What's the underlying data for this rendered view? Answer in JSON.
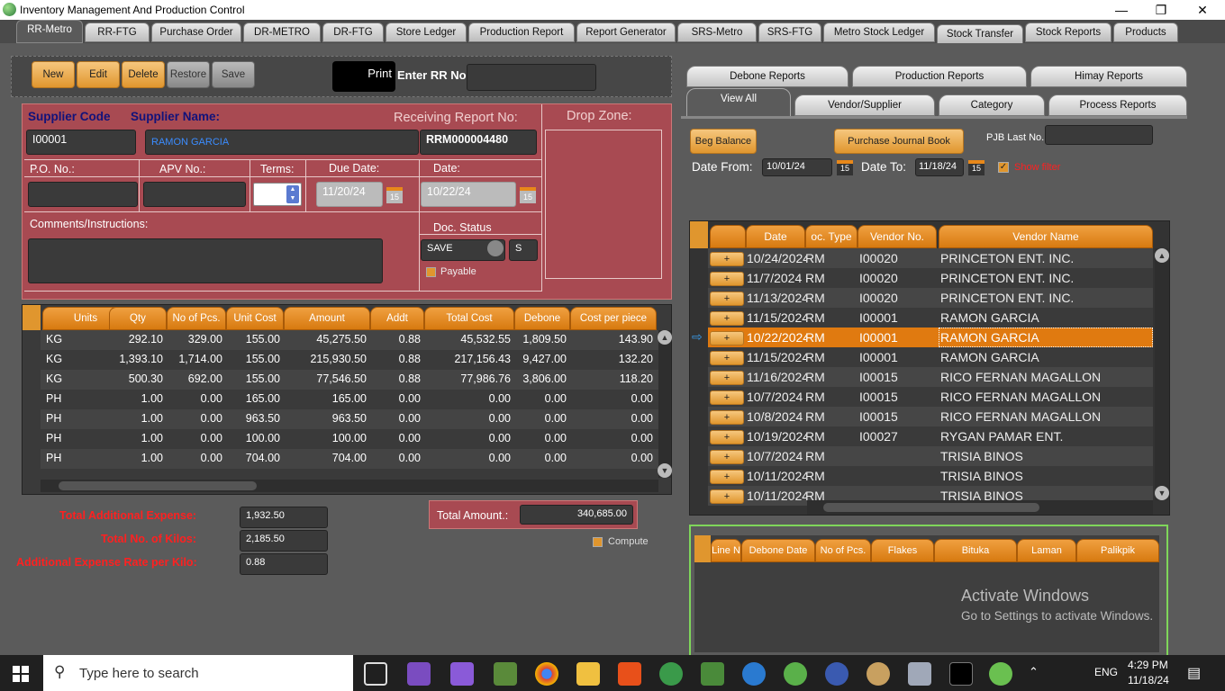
{
  "window": {
    "title": "Inventory Management And Production Control",
    "min": "—",
    "max": "❐",
    "close": "✕"
  },
  "tabs": [
    "RR-Metro",
    "RR-FTG",
    "Purchase Order",
    "DR-METRO",
    "DR-FTG",
    "Store Ledger",
    "Production Report",
    "Report Generator",
    "SRS-Metro",
    "SRS-FTG",
    "Metro Stock Ledger",
    "Stock Transfer",
    "Stock Reports",
    "Products"
  ],
  "toolbar": {
    "new": "New",
    "edit": "Edit",
    "delete": "Delete",
    "restore": "Restore",
    "save": "Save",
    "print": "Print",
    "enter_rr_label": "Enter RR No.:",
    "enter_rr_value": ""
  },
  "form": {
    "supplier_code_label": "Supplier Code",
    "supplier_name_label": "Supplier Name:",
    "rr_label": "Receiving Report No:",
    "drop_zone_label": "Drop Zone:",
    "supplier_code": "I00001",
    "supplier_name": "RAMON  GARCIA",
    "rr_no": "RRM000004480",
    "po_label": "P.O. No.:",
    "apv_label": "APV No.:",
    "terms_label": "Terms:",
    "due_label": "Due Date:",
    "date_label": "Date:",
    "po_value": "",
    "apv_value": "",
    "due_date": "11/20/24",
    "date": "10/22/24",
    "calendar_icon_text": "15",
    "comments_label": "Comments/Instructions:",
    "doc_status_label": "Doc. Status",
    "doc_status": "SAVE",
    "doc_status_code": "S",
    "payable_label": "Payable"
  },
  "items_grid": {
    "headers": [
      "Units",
      "Qty",
      "No of Pcs.",
      "Unit Cost",
      "Amount",
      "Addt UCost",
      "Total Cost",
      "Debone UC",
      "Cost per piece"
    ],
    "rows": [
      [
        "KG",
        "292.10",
        "329.00",
        "155.00",
        "45,275.50",
        "0.88",
        "45,532.55",
        "1,809.50",
        "143.90"
      ],
      [
        "KG",
        "1,393.10",
        "1,714.00",
        "155.00",
        "215,930.50",
        "0.88",
        "217,156.43",
        "9,427.00",
        "132.20"
      ],
      [
        "KG",
        "500.30",
        "692.00",
        "155.00",
        "77,546.50",
        "0.88",
        "77,986.76",
        "3,806.00",
        "118.20"
      ],
      [
        "PH",
        "1.00",
        "0.00",
        "165.00",
        "165.00",
        "0.00",
        "0.00",
        "0.00",
        "0.00"
      ],
      [
        "PH",
        "1.00",
        "0.00",
        "963.50",
        "963.50",
        "0.00",
        "0.00",
        "0.00",
        "0.00"
      ],
      [
        "PH",
        "1.00",
        "0.00",
        "100.00",
        "100.00",
        "0.00",
        "0.00",
        "0.00",
        "0.00"
      ],
      [
        "PH",
        "1.00",
        "0.00",
        "704.00",
        "704.00",
        "0.00",
        "0.00",
        "0.00",
        "0.00"
      ]
    ]
  },
  "totals": {
    "add_expense_label": "Total Additional Expense:",
    "add_expense": "1,932.50",
    "kilos_label": "Total No. of Kilos:",
    "kilos": "2,185.50",
    "rate_label": "Additional Expense Rate per Kilo:",
    "rate": "0.88",
    "total_amount_label": "Total Amount.:",
    "total_amount": "340,685.00",
    "compute_label": "Compute"
  },
  "right": {
    "tabs_row1": [
      "Debone Reports",
      "Production Reports",
      "Himay Reports"
    ],
    "tabs_row2": [
      "View All",
      "Vendor/Supplier",
      "Category",
      "Process Reports"
    ],
    "beg_balance": "Beg Balance",
    "pjb": "Purchase Journal Book",
    "pjb_last_label": "PJB Last No.:",
    "pjb_last_value": "",
    "date_from_label": "Date From:",
    "date_from": "10/01/24",
    "date_to_label": "Date To:",
    "date_to": "11/18/24",
    "show_filter": "Show filter",
    "grid_headers": [
      "Date",
      "oc. Type",
      "Vendor No.",
      "Vendor Name"
    ],
    "plus": "+",
    "rows": [
      [
        "10/24/2024",
        "RM",
        "I00020",
        "PRINCETON ENT. INC."
      ],
      [
        "11/7/2024",
        "RM",
        "I00020",
        "PRINCETON ENT. INC."
      ],
      [
        "11/13/2024",
        "RM",
        "I00020",
        "PRINCETON ENT. INC."
      ],
      [
        "11/15/2024",
        "RM",
        "I00001",
        "RAMON  GARCIA"
      ],
      [
        "10/22/2024",
        "RM",
        "I00001",
        "RAMON  GARCIA"
      ],
      [
        "11/15/2024",
        "RM",
        "I00001",
        "RAMON  GARCIA"
      ],
      [
        "11/16/2024",
        "RM",
        "I00015",
        "RICO FERNAN  MAGALLON"
      ],
      [
        "10/7/2024",
        "RM",
        "I00015",
        "RICO FERNAN MAGALLON"
      ],
      [
        "10/8/2024",
        "RM",
        "I00015",
        "RICO FERNAN MAGALLON"
      ],
      [
        "10/19/2024",
        "RM",
        "I00027",
        "RYGAN PAMAR ENT."
      ],
      [
        "10/7/2024",
        "RM",
        "",
        "TRISIA BINOS"
      ],
      [
        "10/11/2024",
        "RM",
        "",
        "TRISIA BINOS"
      ],
      [
        "10/11/2024",
        "RM",
        "",
        "TRISIA BINOS"
      ]
    ],
    "selected_index": 4,
    "debone_headers": [
      "Line N",
      "Debone Date",
      "No of Pcs.",
      "Flakes",
      "Bituka",
      "Laman",
      "Palikpik"
    ],
    "watermark_title": "Activate Windows",
    "watermark_sub": "Go to Settings to activate Windows."
  },
  "taskbar": {
    "search": "Type here to search",
    "lang": "ENG",
    "time": "4:29 PM",
    "date": "11/18/24"
  },
  "colors": {
    "orange": "#e0962e",
    "red_panel": "#a84a52",
    "selected_row": "#e07a10"
  }
}
